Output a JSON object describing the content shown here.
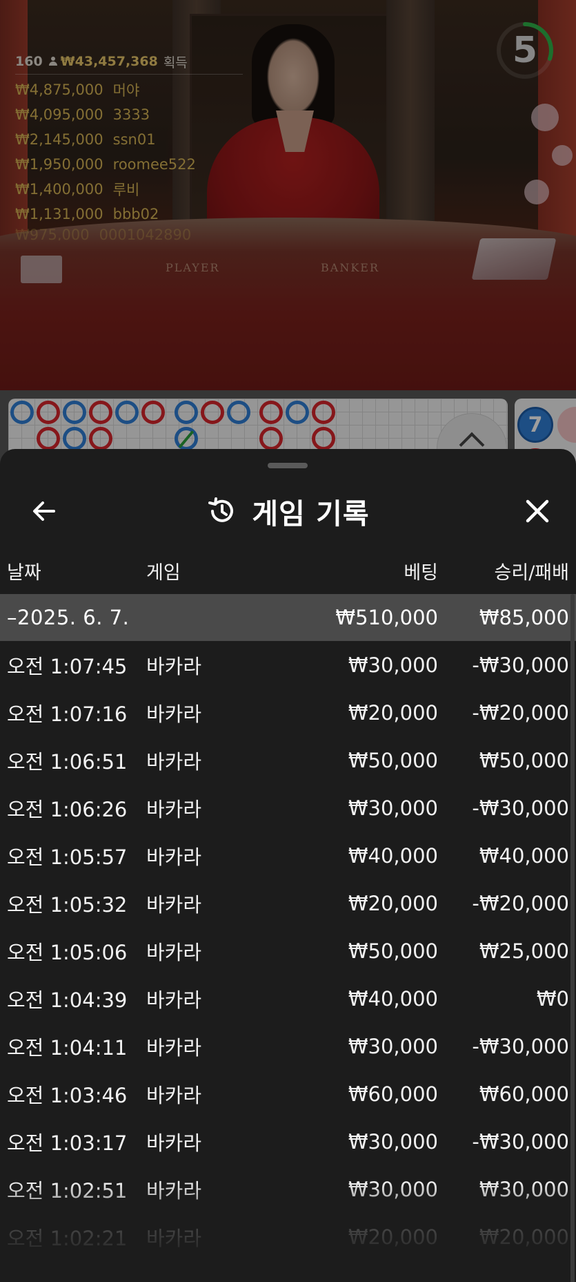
{
  "live": {
    "winners_header": {
      "count": "160",
      "total": "₩43,457,368",
      "suffix": "획득"
    },
    "winners": [
      {
        "amount": "₩4,875,000",
        "name": "머야"
      },
      {
        "amount": "₩4,095,000",
        "name": "3333"
      },
      {
        "amount": "₩2,145,000",
        "name": "ssn01"
      },
      {
        "amount": "₩1,950,000",
        "name": "roomee522"
      },
      {
        "amount": "₩1,400,000",
        "name": "루비"
      },
      {
        "amount": "₩1,131,000",
        "name": "bbb02"
      },
      {
        "amount": "₩975,000",
        "name": "0001042890"
      }
    ],
    "timer": "5",
    "table_labels": {
      "player": "PLAYER",
      "banker": "BANKER"
    }
  },
  "roadmap": {
    "side_badge": "7",
    "colors": {
      "player": "#2f7fd6",
      "banker": "#d8262c",
      "tie": "#2a9e3a"
    }
  },
  "sheet": {
    "title": "게임 기록",
    "icons": {
      "back": "arrow-left-icon",
      "history": "history-icon",
      "close": "close-icon"
    },
    "columns": {
      "date": "날짜",
      "game": "게임",
      "bet": "베팅",
      "result": "승리/패배"
    },
    "group": {
      "date": "–2025. 6. 7.",
      "bet": "₩510,000",
      "result": "₩85,000"
    },
    "rows": [
      {
        "time": "오전 1:07:45",
        "game": "바카라",
        "bet": "₩30,000",
        "result": "-₩30,000"
      },
      {
        "time": "오전 1:07:16",
        "game": "바카라",
        "bet": "₩20,000",
        "result": "-₩20,000"
      },
      {
        "time": "오전 1:06:51",
        "game": "바카라",
        "bet": "₩50,000",
        "result": "₩50,000"
      },
      {
        "time": "오전 1:06:26",
        "game": "바카라",
        "bet": "₩30,000",
        "result": "-₩30,000"
      },
      {
        "time": "오전 1:05:57",
        "game": "바카라",
        "bet": "₩40,000",
        "result": "₩40,000"
      },
      {
        "time": "오전 1:05:32",
        "game": "바카라",
        "bet": "₩20,000",
        "result": "-₩20,000"
      },
      {
        "time": "오전 1:05:06",
        "game": "바카라",
        "bet": "₩50,000",
        "result": "₩25,000"
      },
      {
        "time": "오전 1:04:39",
        "game": "바카라",
        "bet": "₩40,000",
        "result": "₩0"
      },
      {
        "time": "오전 1:04:11",
        "game": "바카라",
        "bet": "₩30,000",
        "result": "-₩30,000"
      },
      {
        "time": "오전 1:03:46",
        "game": "바카라",
        "bet": "₩60,000",
        "result": "₩60,000"
      },
      {
        "time": "오전 1:03:17",
        "game": "바카라",
        "bet": "₩30,000",
        "result": "-₩30,000"
      },
      {
        "time": "오전 1:02:51",
        "game": "바카라",
        "bet": "₩30,000",
        "result": "₩30,000"
      },
      {
        "time": "오전 1:02:21",
        "game": "바카라",
        "bet": "₩20,000",
        "result": "₩20,000"
      }
    ]
  }
}
